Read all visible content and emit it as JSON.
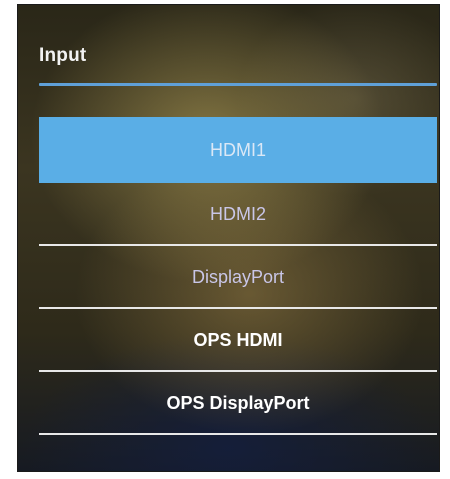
{
  "menu": {
    "title": "Input",
    "accent_color": "#5aaee6",
    "options": [
      {
        "label": "HDMI1",
        "selected": true
      },
      {
        "label": "HDMI2",
        "selected": false
      },
      {
        "label": "DisplayPort",
        "selected": false
      },
      {
        "label": "OPS HDMI",
        "selected": false
      },
      {
        "label": "OPS DisplayPort",
        "selected": false
      }
    ]
  }
}
